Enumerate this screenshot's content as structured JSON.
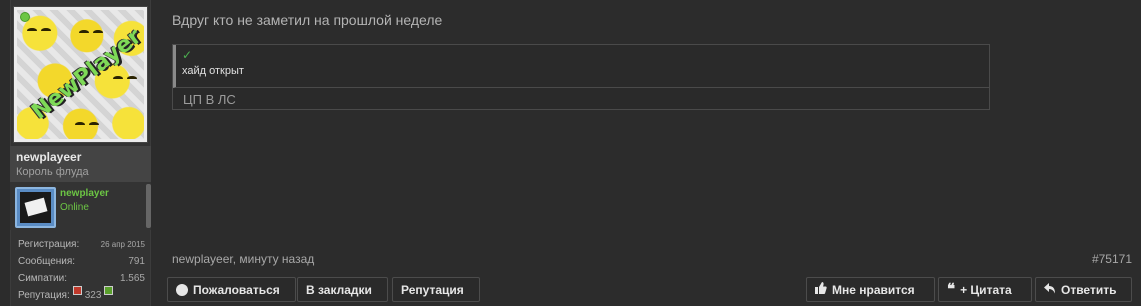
{
  "user": {
    "name": "newplayeer",
    "title": "Король флуда",
    "avatar_logo": "NewPlayer",
    "online": true
  },
  "mini_profile": {
    "name": "newplayer",
    "status": "Online"
  },
  "stats": [
    {
      "label": "Регистрация:",
      "value": "26 апр 2015"
    },
    {
      "label": "Сообщения:",
      "value": "791"
    },
    {
      "label": "Симпатии:",
      "value": "1.565"
    },
    {
      "label": "Репутация:",
      "value": "323"
    }
  ],
  "post": {
    "text": "Вдруг кто не заметил на прошлой неделе",
    "hide": {
      "check": "✓",
      "label": "хайд открыт",
      "content": "ЦП В ЛС"
    },
    "meta": "newplayeer, минуту назад",
    "number": "#75171"
  },
  "actions_left": [
    {
      "label": "Пожаловаться",
      "icon": "report-icon"
    },
    {
      "label": "В закладки"
    },
    {
      "label": "Репутация"
    }
  ],
  "actions_right": [
    {
      "label": "Мне нравится",
      "icon": "thumbs-up-icon"
    },
    {
      "label": "+ Цитата",
      "icon": "quote-icon"
    },
    {
      "label": "Ответить",
      "icon": "reply-icon"
    }
  ],
  "colors": {
    "background": "#2c2c2c",
    "online": "#6cc644",
    "check": "#4caf50"
  }
}
